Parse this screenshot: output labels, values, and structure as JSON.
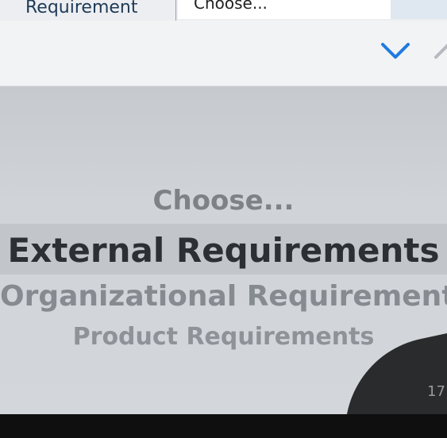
{
  "form": {
    "label": "Requirement",
    "select_value": "Choose..."
  },
  "toolbar": {
    "next_icon": "chevron-down-icon",
    "prev_icon": "chevron-up-icon"
  },
  "picker": {
    "options": [
      "Choose...",
      "External Requirements",
      "Organizational Requirements",
      "Product Requirements"
    ],
    "selected": "External Requirements"
  },
  "colors": {
    "accent": "#1f7ae0",
    "label": "#1f3a56"
  },
  "corner_text": "17"
}
